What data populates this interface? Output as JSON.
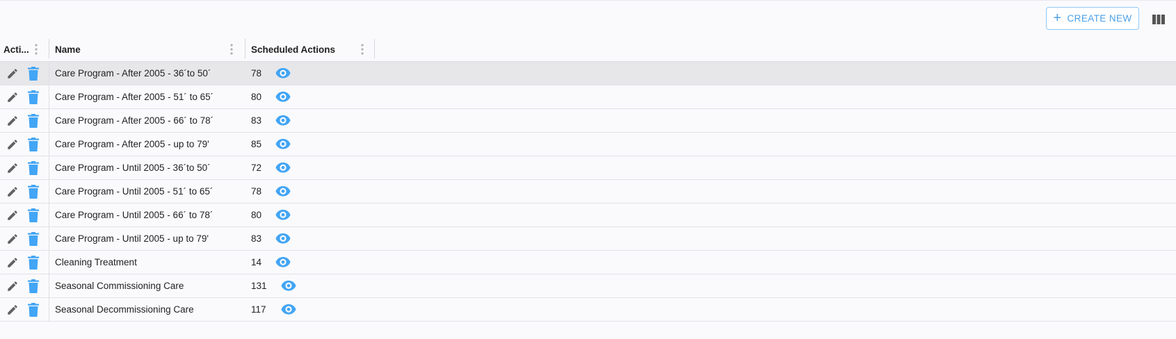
{
  "toolbar": {
    "create_label": "CREATE NEW",
    "create_icon": "plus-icon",
    "columns_icon": "view-columns-icon"
  },
  "table": {
    "columns": [
      "Acti...",
      "Name",
      "Scheduled Actions"
    ],
    "rows": [
      {
        "name": "Care Program - After 2005 - 36´to 50´",
        "scheduled_actions": "78",
        "selected": true
      },
      {
        "name": "Care Program - After 2005 - 51´ to 65´",
        "scheduled_actions": "80"
      },
      {
        "name": "Care Program - After 2005 - 66´ to 78´",
        "scheduled_actions": "83"
      },
      {
        "name": "Care Program - After 2005 - up to 79'",
        "scheduled_actions": "85"
      },
      {
        "name": "Care Program - Until 2005 - 36´to 50´",
        "scheduled_actions": "72"
      },
      {
        "name": "Care Program - Until 2005 - 51´ to 65´",
        "scheduled_actions": "78"
      },
      {
        "name": "Care Program - Until 2005 - 66´ to 78´",
        "scheduled_actions": "80"
      },
      {
        "name": "Care Program - Until 2005 - up to 79'",
        "scheduled_actions": "83"
      },
      {
        "name": "Cleaning Treatment",
        "scheduled_actions": "14"
      },
      {
        "name": "Seasonal Commissioning Care",
        "scheduled_actions": "131"
      },
      {
        "name": "Seasonal Decommissioning Care",
        "scheduled_actions": "117"
      }
    ]
  },
  "colors": {
    "accent": "#42a5f5",
    "edit_icon": "#616161",
    "selected_row": "#e7e7ea"
  }
}
